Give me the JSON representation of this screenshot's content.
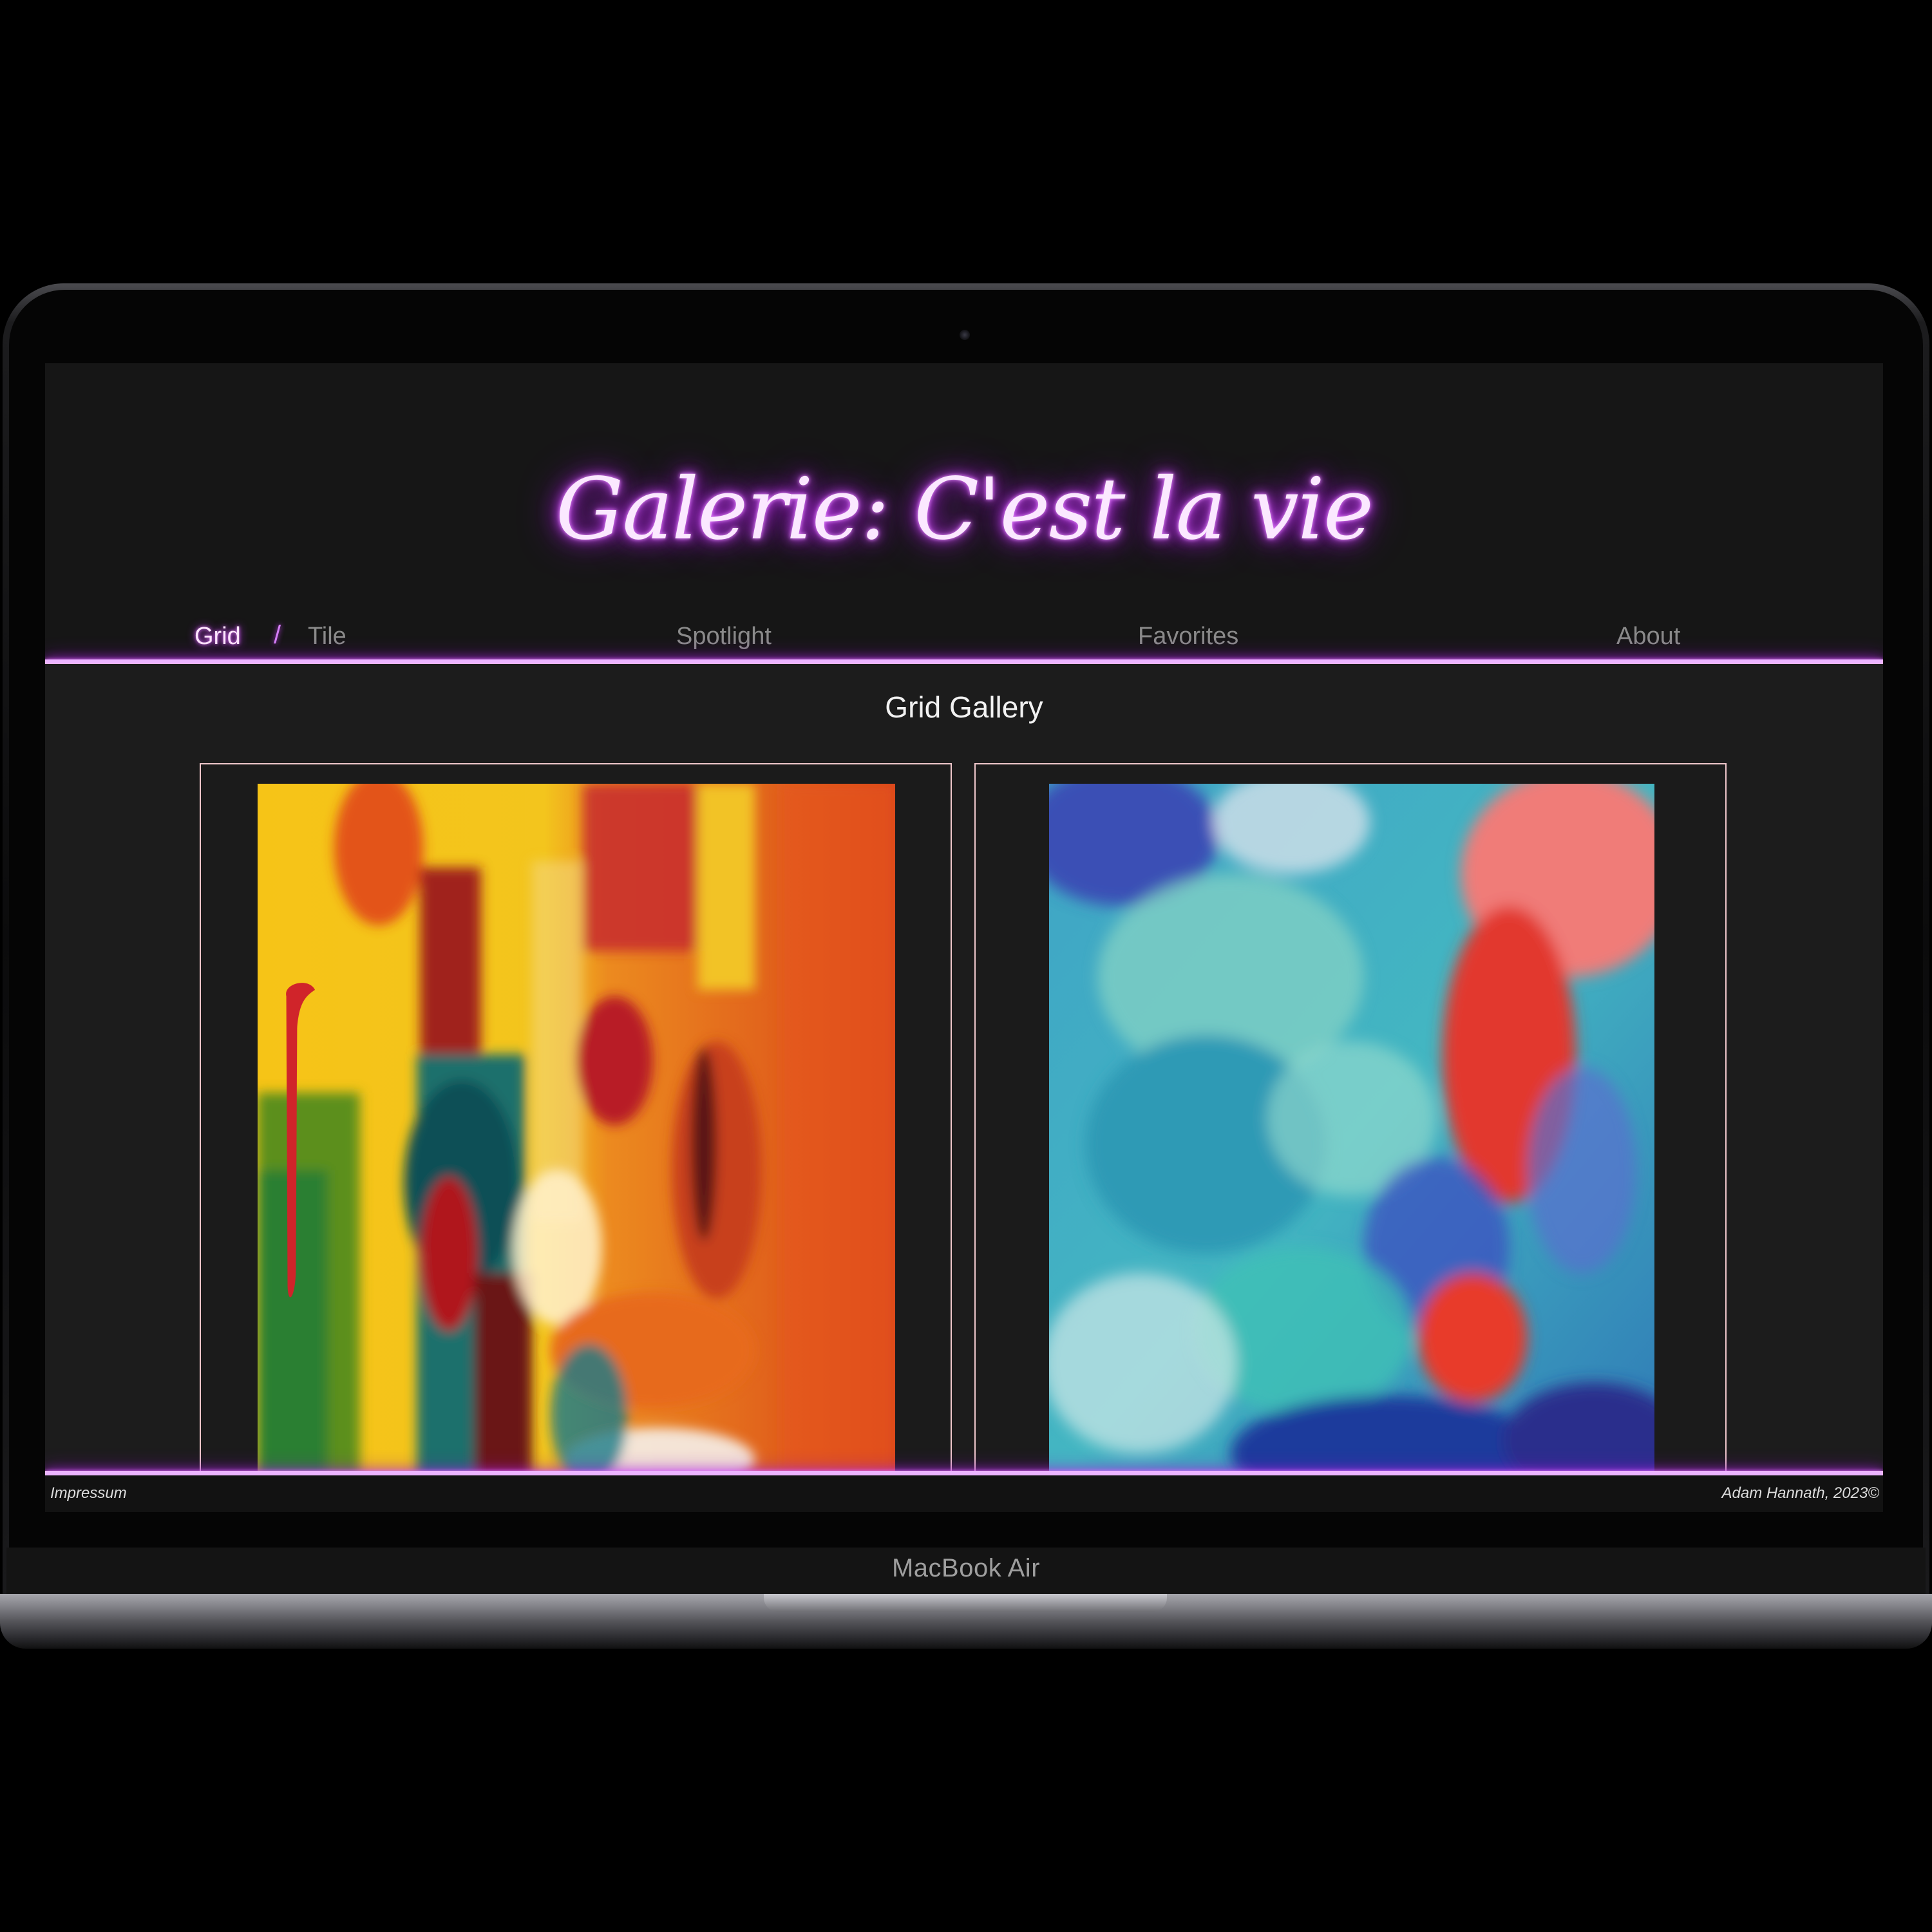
{
  "device": {
    "label": "MacBook Air"
  },
  "site": {
    "title": "Galerie: C'est la vie",
    "accent_color": "#d052ff"
  },
  "nav": {
    "grid": "Grid",
    "separator": "/",
    "tile": "Tile",
    "spotlight": "Spotlight",
    "favorites": "Favorites",
    "about": "About",
    "active": "Grid"
  },
  "main": {
    "heading": "Grid Gallery",
    "artworks": [
      {
        "palette": "yellow-orange-red-teal abstract"
      },
      {
        "palette": "turquoise-blue-red abstract"
      }
    ]
  },
  "footer": {
    "left": "Impressum",
    "right": "Adam Hannath, 2023©"
  }
}
